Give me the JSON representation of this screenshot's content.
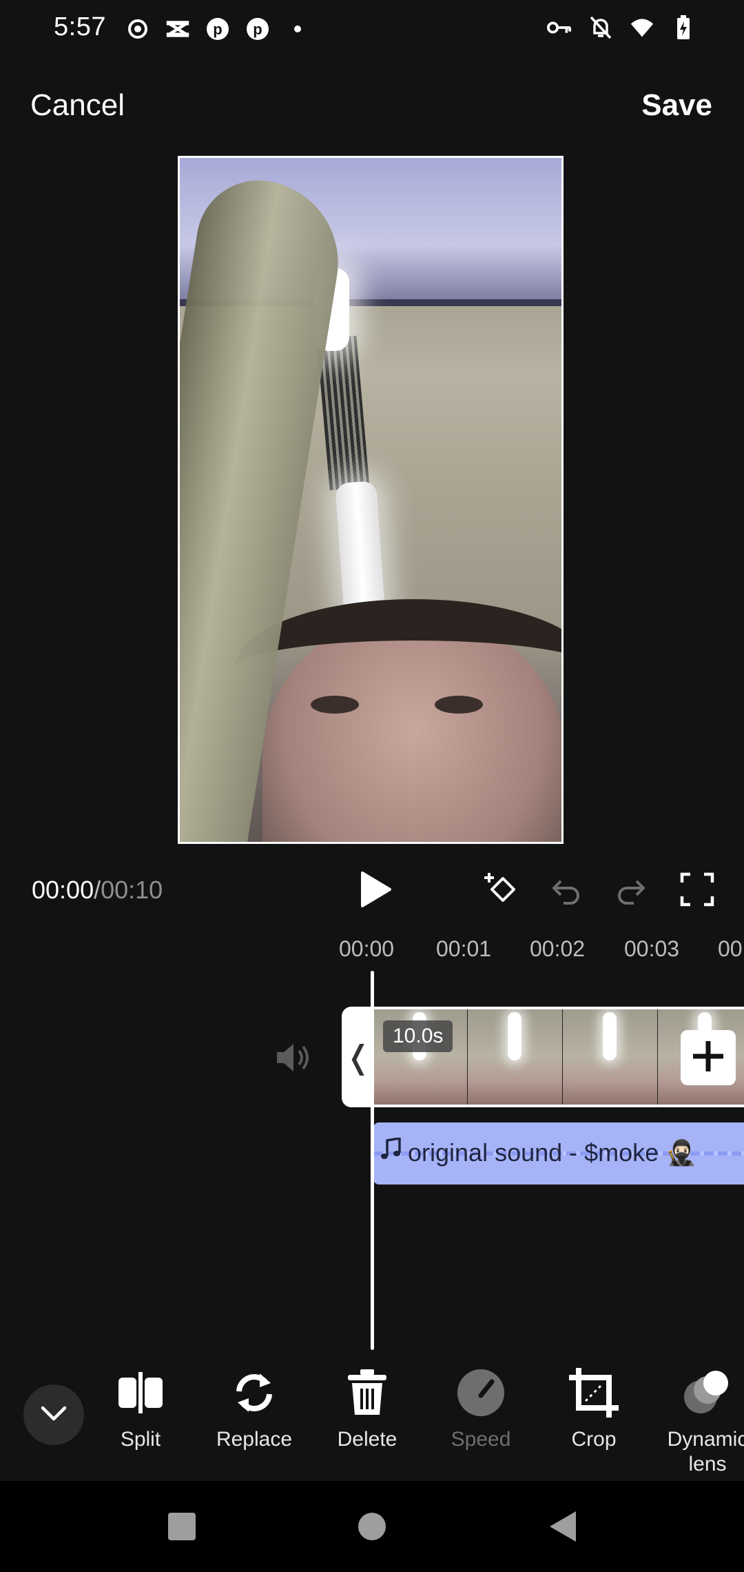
{
  "status_bar": {
    "time": "5:57",
    "left_icons": [
      "record-icon",
      "capcut-icon",
      "pinterest-icon",
      "pinterest-icon",
      "dot-icon"
    ],
    "right_icons": [
      "vpn-key-icon",
      "bell-off-icon",
      "wifi-icon",
      "battery-charging-icon"
    ]
  },
  "header": {
    "cancel_label": "Cancel",
    "save_label": "Save"
  },
  "player": {
    "current_time": "00:00",
    "separator": "/",
    "total_time": "00:10"
  },
  "ruler": {
    "ticks": [
      "00:00",
      "00:01",
      "00:02",
      "00:03",
      "00"
    ]
  },
  "clip": {
    "duration": "10.0s",
    "handle_glyph": "❬"
  },
  "audio": {
    "label": "original sound - $moke 🥷🏻"
  },
  "toolbar": {
    "items": [
      {
        "label": "Split",
        "icon": "split-icon",
        "enabled": true
      },
      {
        "label": "Replace",
        "icon": "replace-icon",
        "enabled": true
      },
      {
        "label": "Delete",
        "icon": "trash-icon",
        "enabled": true
      },
      {
        "label": "Speed",
        "icon": "speed-icon",
        "enabled": false
      },
      {
        "label": "Crop",
        "icon": "crop-icon",
        "enabled": true
      },
      {
        "label": "Dynamic\nlens",
        "icon": "dynamic-lens-icon",
        "enabled": true
      }
    ]
  }
}
